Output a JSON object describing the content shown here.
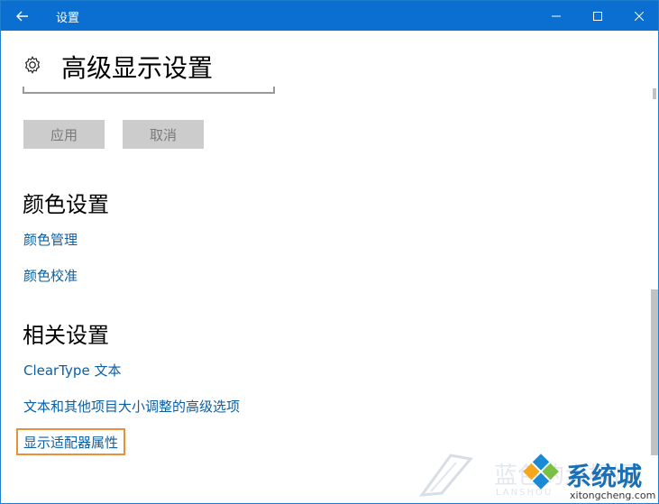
{
  "window": {
    "title": "设置",
    "icons": {
      "back": "arrow-left-icon",
      "minimize": "minimize-icon",
      "maximize": "maximize-icon",
      "close": "close-icon"
    },
    "accent": "#0a6fd0"
  },
  "header": {
    "icon": "gear-icon",
    "title": "高级显示设置"
  },
  "buttons": {
    "apply": "应用",
    "cancel": "取消"
  },
  "color_section": {
    "title": "颜色设置",
    "links": [
      "颜色管理",
      "颜色校准"
    ]
  },
  "related_section": {
    "title": "相关设置",
    "links": [
      "ClearType 文本",
      "文本和其他项目大小调整的高级选项",
      "显示适配器属性"
    ]
  },
  "watermark": {
    "brand_cn": "系统城",
    "domain": "xitongcheng.com",
    "faint_text": "蓝色的大柯姆",
    "faint_en": "LANSHOU"
  },
  "colors": {
    "link": "#0a5fa6",
    "highlight": "#e8903a"
  }
}
